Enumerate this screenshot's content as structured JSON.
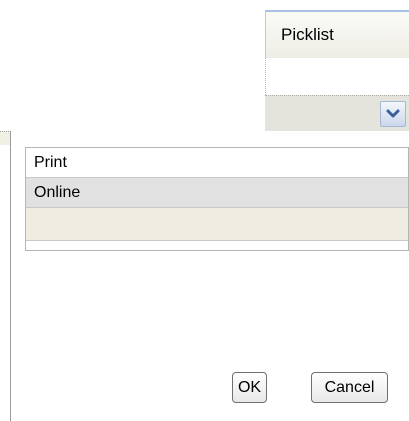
{
  "column_header": {
    "label": "Picklist"
  },
  "filter": {
    "dropdown_icon": "chevron-down-icon"
  },
  "picklist_popup": {
    "options": [
      {
        "label": "Print",
        "selected": false
      },
      {
        "label": "Online",
        "selected": true
      },
      {
        "label": "",
        "selected": false
      }
    ],
    "ok_label": "OK",
    "cancel_label": "Cancel"
  },
  "colors": {
    "header_accent": "#a9c2e3",
    "selected_row": "#e1e1e1",
    "blank_row": "#efede2",
    "dropdown_arrow": "#3b5f9b"
  }
}
